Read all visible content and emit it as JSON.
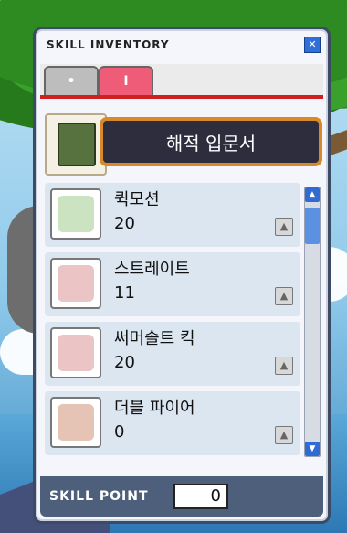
{
  "window": {
    "title": "SKILL INVENTORY",
    "close_icon": "close-icon"
  },
  "tabs": [
    {
      "label": "•",
      "icon": "tab-dot"
    },
    {
      "label": "I",
      "icon": "tab-1"
    }
  ],
  "book": {
    "title": "해적 입문서",
    "icon": "green-book-icon"
  },
  "skills": [
    {
      "name": "퀵모션",
      "level": "20",
      "icon": "quick-motion-icon",
      "color": "#6ab04c"
    },
    {
      "name": "스트레이트",
      "level": "11",
      "icon": "straight-icon",
      "color": "#c75a5a"
    },
    {
      "name": "써머솔트 킥",
      "level": "20",
      "icon": "somersault-kick-icon",
      "color": "#c75a5a"
    },
    {
      "name": "더블 파이어",
      "level": "0",
      "icon": "double-fire-icon",
      "color": "#b5522b"
    }
  ],
  "footer": {
    "label": "SKILL POINT",
    "value": "0"
  },
  "colors": {
    "tab_active": "#ee5c78",
    "divider": "#cf1f1f",
    "footer": "#4d5f7a"
  }
}
